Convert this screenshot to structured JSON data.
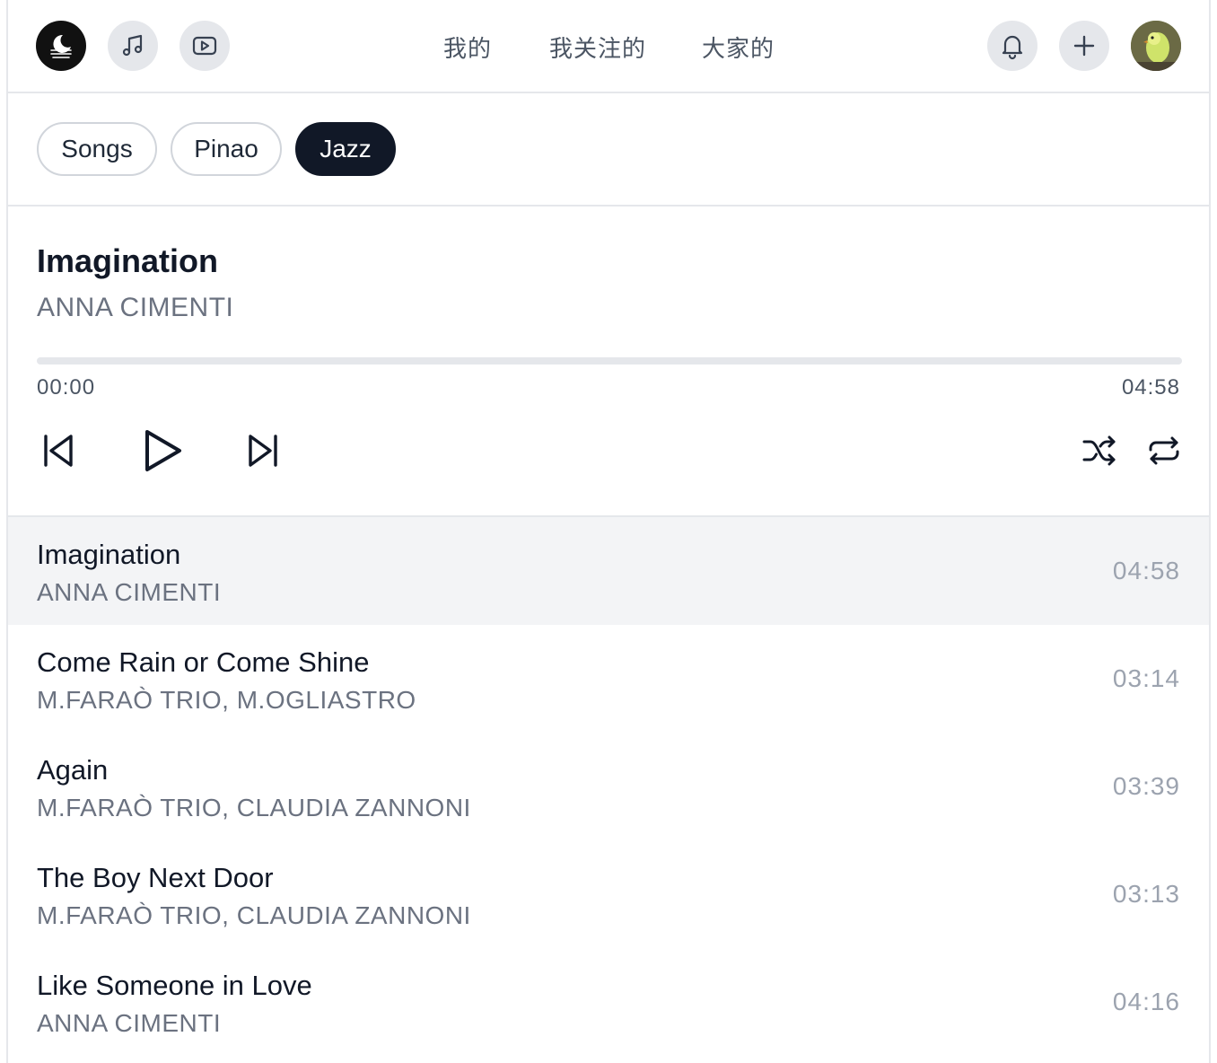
{
  "header": {
    "nav": [
      "我的",
      "我关注的",
      "大家的"
    ]
  },
  "tags": [
    {
      "label": "Songs",
      "active": false
    },
    {
      "label": "Pinao",
      "active": false
    },
    {
      "label": "Jazz",
      "active": true
    }
  ],
  "now_playing": {
    "title": "Imagination",
    "artist": "ANNA CIMENTI",
    "current_time": "00:00",
    "total_time": "04:58",
    "progress": 0
  },
  "tracks": [
    {
      "title": "Imagination",
      "artist": "ANNA CIMENTI",
      "duration": "04:58"
    },
    {
      "title": "Come Rain or Come Shine",
      "artist": "M.FARAÒ TRIO, M.OGLIASTRO",
      "duration": "03:14"
    },
    {
      "title": "Again",
      "artist": "M.FARAÒ TRIO, CLAUDIA ZANNONI",
      "duration": "03:39"
    },
    {
      "title": "The Boy Next Door",
      "artist": "M.FARAÒ TRIO, CLAUDIA ZANNONI",
      "duration": "03:13"
    },
    {
      "title": "Like Someone in Love",
      "artist": "ANNA CIMENTI",
      "duration": "04:16"
    }
  ],
  "icons": {
    "logo": "moon-waves-icon",
    "music": "music-note-icon",
    "video": "video-play-icon",
    "notifications": "bell-icon",
    "add": "plus-icon",
    "prev": "skip-previous-icon",
    "play": "play-icon",
    "next": "skip-next-icon",
    "shuffle": "shuffle-icon",
    "repeat": "repeat-icon"
  },
  "colors": {
    "accent": "#111827",
    "muted_text": "#6b7280",
    "icon_bg": "#e5e7eb",
    "active_row_bg": "#f3f4f6"
  }
}
